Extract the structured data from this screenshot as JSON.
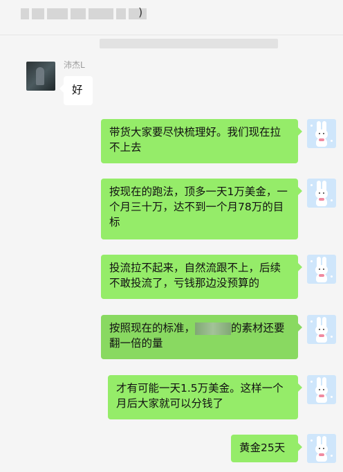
{
  "header": {
    "title_suffix": ")"
  },
  "sender": {
    "name": "沛杰L"
  },
  "messages": [
    {
      "from": "in",
      "text": "好"
    },
    {
      "from": "out",
      "text": "带货大家要尽快梳理好。我们现在拉不上去"
    },
    {
      "from": "out",
      "text": "按现在的跑法，顶多一天1万美金，一个月三十万，达不到一个月78万的目标"
    },
    {
      "from": "out",
      "text": "投流拉不起来，自然流跟不上，后续不敢投流了，亏钱那边没预算的"
    },
    {
      "from": "out",
      "text_before": "按照现在的标准，",
      "text_after": "的素材还要翻一倍的量"
    },
    {
      "from": "out",
      "text": "才有可能一天1.5万美金。这样一个月后大家就可以分钱了"
    },
    {
      "from": "out",
      "text": "黄金25天"
    }
  ],
  "icons": {
    "left_avatar": "user-avatar-photo-icon",
    "right_avatar": "bunny-avatar-icon"
  },
  "colors": {
    "background": "#f5f5f5",
    "incoming_bubble": "#ffffff",
    "outgoing_bubble": "#95ec69",
    "outgoing_bubble_selected": "#89d961",
    "sender_name": "#9a9a9a"
  }
}
